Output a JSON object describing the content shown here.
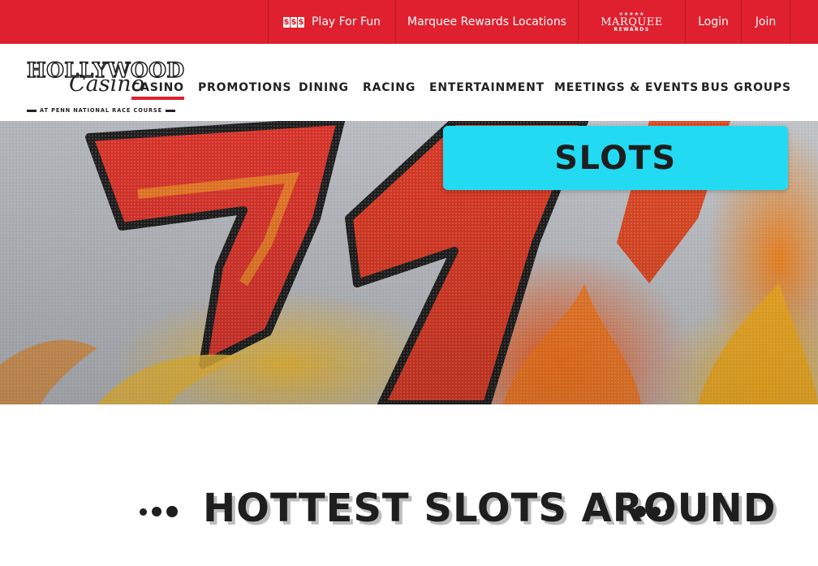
{
  "topbar": {
    "play_for_fun": {
      "icon": "slot-reels-icon",
      "icon_glyphs": [
        "$",
        "$",
        "$"
      ],
      "label": "Play For Fun"
    },
    "locations": "Marquee Rewards Locations",
    "marquee_logo": {
      "stars": "★★★★★",
      "name": "MARQUEE",
      "sub": "REWARDS"
    },
    "login": "Login",
    "join": "Join"
  },
  "brand": {
    "word": "HOLLYWOOD",
    "script": "Casino",
    "tagline": "AT PENN NATIONAL RACE COURSE"
  },
  "nav": {
    "items": [
      {
        "label": "CASINO",
        "active": true
      },
      {
        "label": "PROMOTIONS"
      },
      {
        "label": "DINING"
      },
      {
        "label": "RACING"
      },
      {
        "label": "ENTERTAINMENT"
      },
      {
        "label": "MEETINGS & EVENTS"
      },
      {
        "label": "BUS GROUPS"
      }
    ]
  },
  "hero": {
    "title": "SLOTS"
  },
  "section": {
    "heading": "HOTTEST SLOTS AROUND"
  },
  "colors": {
    "brand_red": "#e0202e",
    "hero_badge": "#22dbf2",
    "text_dark": "#1e1e1e"
  }
}
